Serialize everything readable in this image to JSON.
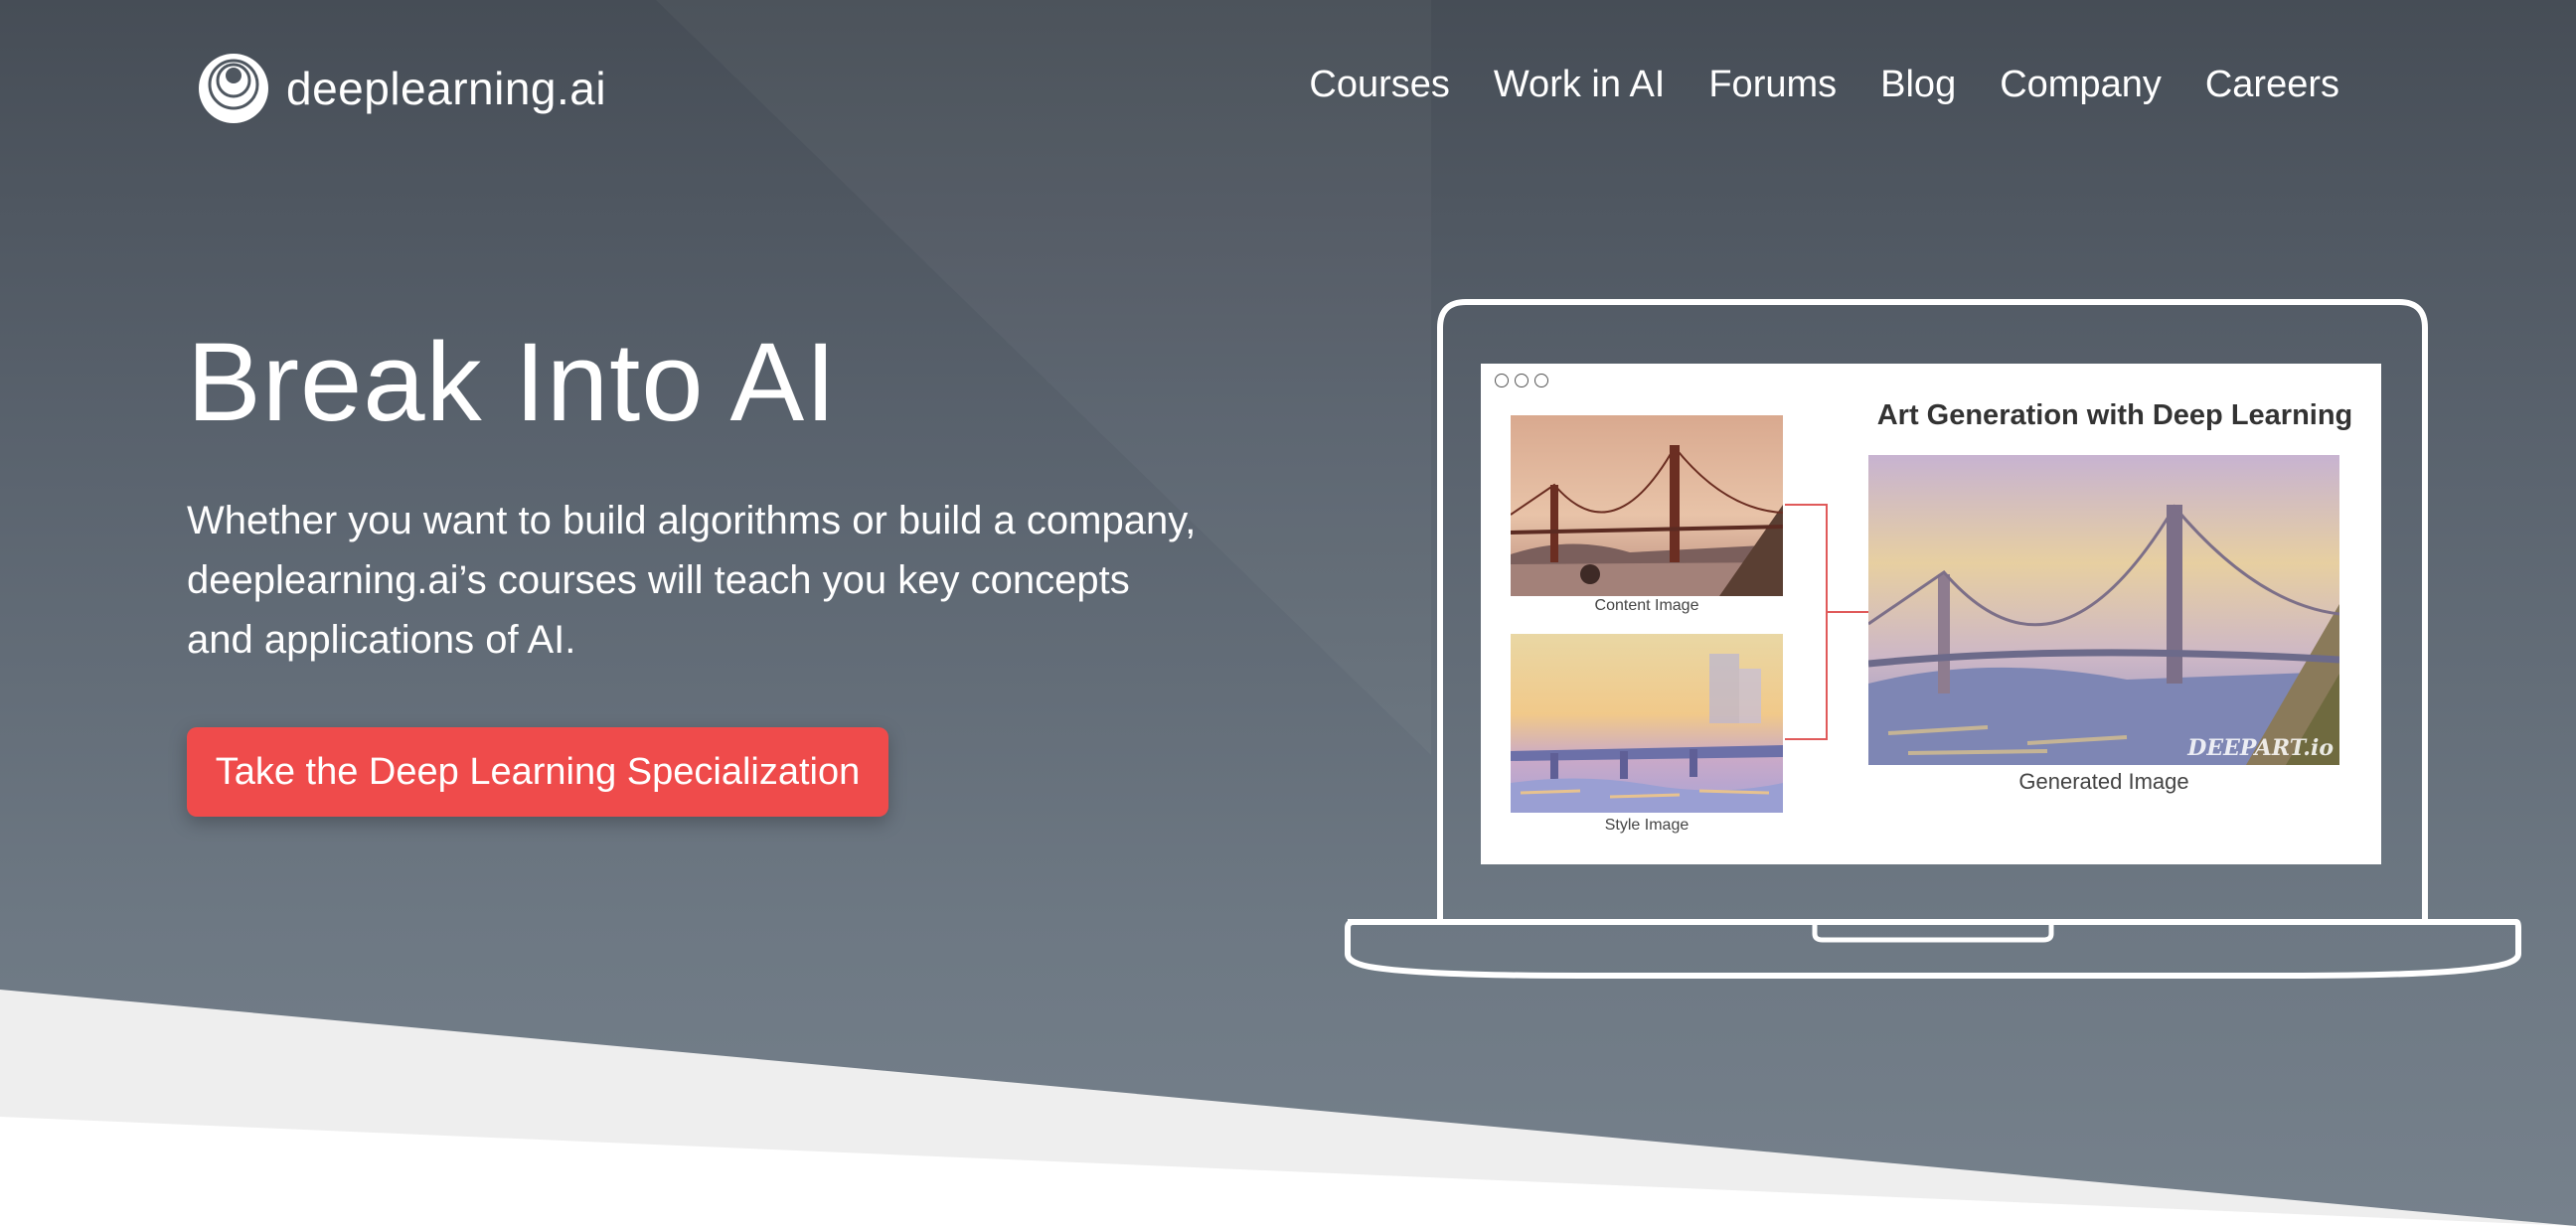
{
  "brand": {
    "name": "deeplearning.ai"
  },
  "nav": {
    "items": [
      "Courses",
      "Work in AI",
      "Forums",
      "Blog",
      "Company",
      "Careers"
    ]
  },
  "hero": {
    "title": "Break Into AI",
    "subtitle": "Whether you want to build algorithms or build a company, deeplearning.ai’s courses will teach you key concepts and applications of AI.",
    "cta_label": "Take the Deep Learning Specialization"
  },
  "illustration": {
    "title": "Art Generation with Deep Learning",
    "content_caption": "Content Image",
    "style_caption": "Style Image",
    "generated_caption": "Generated Image",
    "watermark": "DEEPART.io"
  },
  "colors": {
    "accent": "#ef4b4b",
    "background_top": "#464d56",
    "background_bottom": "#76818c",
    "connector": "#e05a5a"
  }
}
